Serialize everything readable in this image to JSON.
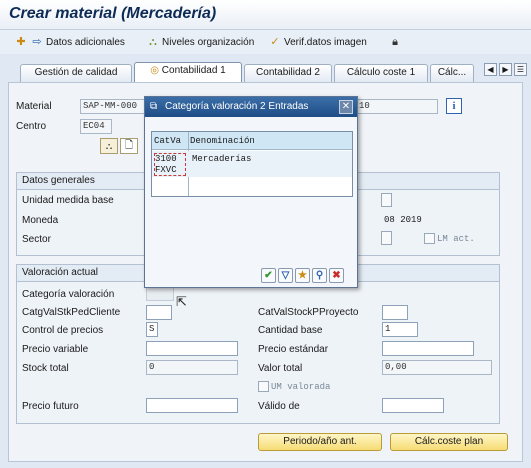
{
  "window": {
    "title": "Crear material (Mercadería)"
  },
  "toolbar": {
    "additional_data": "Datos adicionales",
    "org_levels": "Niveles organización",
    "check_screen": "Verif.datos imagen"
  },
  "tabs": [
    "Gestión de calidad",
    "Contabilidad 1",
    "Contabilidad 2",
    "Cálculo coste 1",
    "Cálc..."
  ],
  "active_tab": "Contabilidad 1",
  "header": {
    "material_label": "Material",
    "material_value": "SAP-MM-000",
    "material_desc_suffix": "10",
    "plant_label": "Centro",
    "plant_value": "EC04"
  },
  "general_data": {
    "title": "Datos generales",
    "base_uom_label": "Unidad medida base",
    "currency_label": "Moneda",
    "sector_label": "Sector",
    "period_value": "08 2019",
    "lm_act_label": "LM act."
  },
  "valuation": {
    "title": "Valoración actual",
    "val_category_label": "Categoría valoración",
    "val_class_sales_label": "CatgValStkPedCliente",
    "val_class_project_label": "CatValStockPProyecto",
    "price_control_label": "Control de precios",
    "price_control_value": "S",
    "price_unit_label": "Cantidad base",
    "price_unit_value": "1",
    "moving_price_label": "Precio variable",
    "standard_price_label": "Precio estándar",
    "total_stock_label": "Stock total",
    "total_stock_value": "0",
    "total_value_label": "Valor total",
    "total_value_value": "0,00",
    "valuated_uom_label": "UM valorada",
    "future_price_label": "Precio futuro",
    "valid_from_label": "Válido de"
  },
  "buttons": {
    "prev_period": "Periodo/año ant.",
    "calc_cost_plan": "Cálc.coste plan"
  },
  "dialog": {
    "title": "Categoría valoración 2 Entradas",
    "col_code": "CatVa",
    "col_desc": "Denominación",
    "rows": [
      {
        "code": "3100",
        "desc": "Mercaderías"
      },
      {
        "code": "FXVC",
        "desc": ""
      }
    ]
  }
}
